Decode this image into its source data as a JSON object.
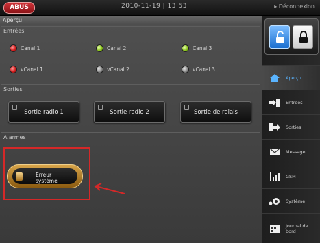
{
  "header": {
    "logo_text": "ABUS",
    "datetime": "2010-11-19 | 13:53",
    "user": "▸ Déconnexion"
  },
  "page_title": "Aperçu",
  "inputs": {
    "title": "Entrées",
    "items": [
      {
        "label": "Canal 1",
        "state": "red"
      },
      {
        "label": "Canal 2",
        "state": "green"
      },
      {
        "label": "Canal 3",
        "state": "green"
      },
      {
        "label": "vCanal 1",
        "state": "red"
      },
      {
        "label": "vCanal 2",
        "state": "gray"
      },
      {
        "label": "vCanal 3",
        "state": "gray"
      }
    ]
  },
  "outputs": {
    "title": "Sorties",
    "buttons": [
      "Sortie radio 1",
      "Sortie radio 2",
      "Sortie de relais"
    ]
  },
  "alarms": {
    "title": "Alarmes",
    "error_button": "Erreur\nsystème"
  },
  "sidebar": {
    "items": [
      {
        "label": "Aperçu",
        "icon": "home-icon",
        "active": true
      },
      {
        "label": "Entrées",
        "icon": "input-arrow-icon"
      },
      {
        "label": "Sorties",
        "icon": "output-arrow-icon"
      },
      {
        "label": "Message",
        "icon": "envelope-icon"
      },
      {
        "label": "GSM",
        "icon": "signal-bars-icon"
      },
      {
        "label": "Système",
        "icon": "gears-icon"
      },
      {
        "label": "Journal de bord",
        "icon": "calendar-icon"
      }
    ]
  },
  "colors": {
    "active_nav": "#5ab4ff",
    "highlight": "#d52828",
    "led_red": "#d31d1d",
    "led_green": "#8cc41e"
  }
}
